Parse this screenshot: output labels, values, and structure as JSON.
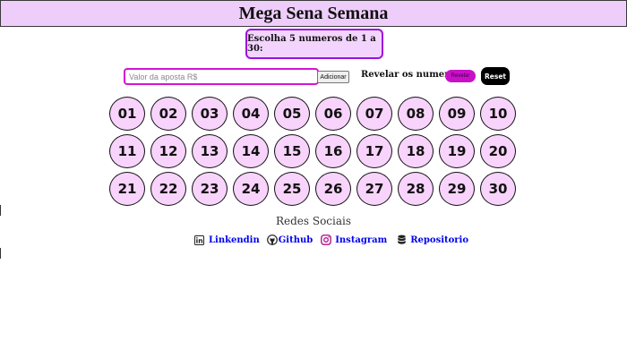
{
  "header": {
    "title": "Mega Sena Semana"
  },
  "instruction": {
    "text": "Escolha 5 numeros de 1 a 30:"
  },
  "bet": {
    "placeholder": "Valor da aposta R$",
    "value": "",
    "add_label": "Adicionar"
  },
  "reveal": {
    "label": "Revelar os numeros",
    "button_label": "Revelar",
    "reset_label": "Reset"
  },
  "numbers": [
    "01",
    "02",
    "03",
    "04",
    "05",
    "06",
    "07",
    "08",
    "09",
    "10",
    "11",
    "12",
    "13",
    "14",
    "15",
    "16",
    "17",
    "18",
    "19",
    "20",
    "21",
    "22",
    "23",
    "24",
    "25",
    "26",
    "27",
    "28",
    "29",
    "30"
  ],
  "social": {
    "title": "Redes Sociais",
    "links": [
      {
        "label": "Linkendin",
        "icon": "linkedin-icon"
      },
      {
        "label": "Github",
        "icon": "github-icon"
      },
      {
        "label": "Instagram",
        "icon": "instagram-icon"
      },
      {
        "label": "Repositorio",
        "icon": "database-icon"
      }
    ]
  },
  "colors": {
    "header_bg": "#efcdfb",
    "ball_bg": "#f8d3fb",
    "accent_border": "#9b12dd",
    "input_border": "#d414d4",
    "reveal_button": "#c910c9",
    "link": "#0000ee"
  }
}
